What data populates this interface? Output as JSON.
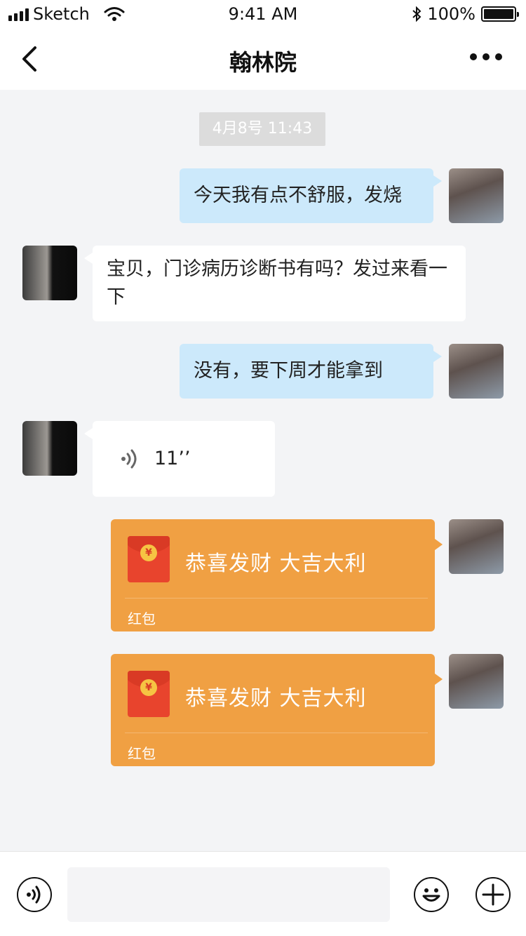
{
  "status_bar": {
    "carrier": "Sketch",
    "time": "9:41 AM",
    "battery": "100%"
  },
  "nav": {
    "title": "翰林院"
  },
  "chat": {
    "timestamp": "4月8号 11:43",
    "messages": [
      {
        "direction": "out",
        "type": "text",
        "text": "今天我有点不舒服，发烧"
      },
      {
        "direction": "in",
        "type": "text",
        "text": "宝贝，门诊病历诊断书有吗？发过来看一下"
      },
      {
        "direction": "out",
        "type": "text",
        "text": "没有，要下周才能拿到"
      },
      {
        "direction": "in",
        "type": "voice",
        "duration": "11’’"
      },
      {
        "direction": "out",
        "type": "red_packet",
        "title": "恭喜发财 大吉大利",
        "label": "红包"
      },
      {
        "direction": "out",
        "type": "red_packet",
        "title": "恭喜发财 大吉大利",
        "label": "红包"
      }
    ]
  },
  "input": {
    "placeholder": ""
  },
  "colors": {
    "bubble_out": "#cce9fb",
    "bubble_in": "#ffffff",
    "red_packet": "#f0a043",
    "background": "#f3f4f6"
  },
  "icons": [
    "signal-icon",
    "wifi-icon",
    "bluetooth-icon",
    "battery-icon",
    "back-icon",
    "more-icon",
    "voice-icon",
    "emoji-icon",
    "plus-icon",
    "yen-coin-icon"
  ]
}
